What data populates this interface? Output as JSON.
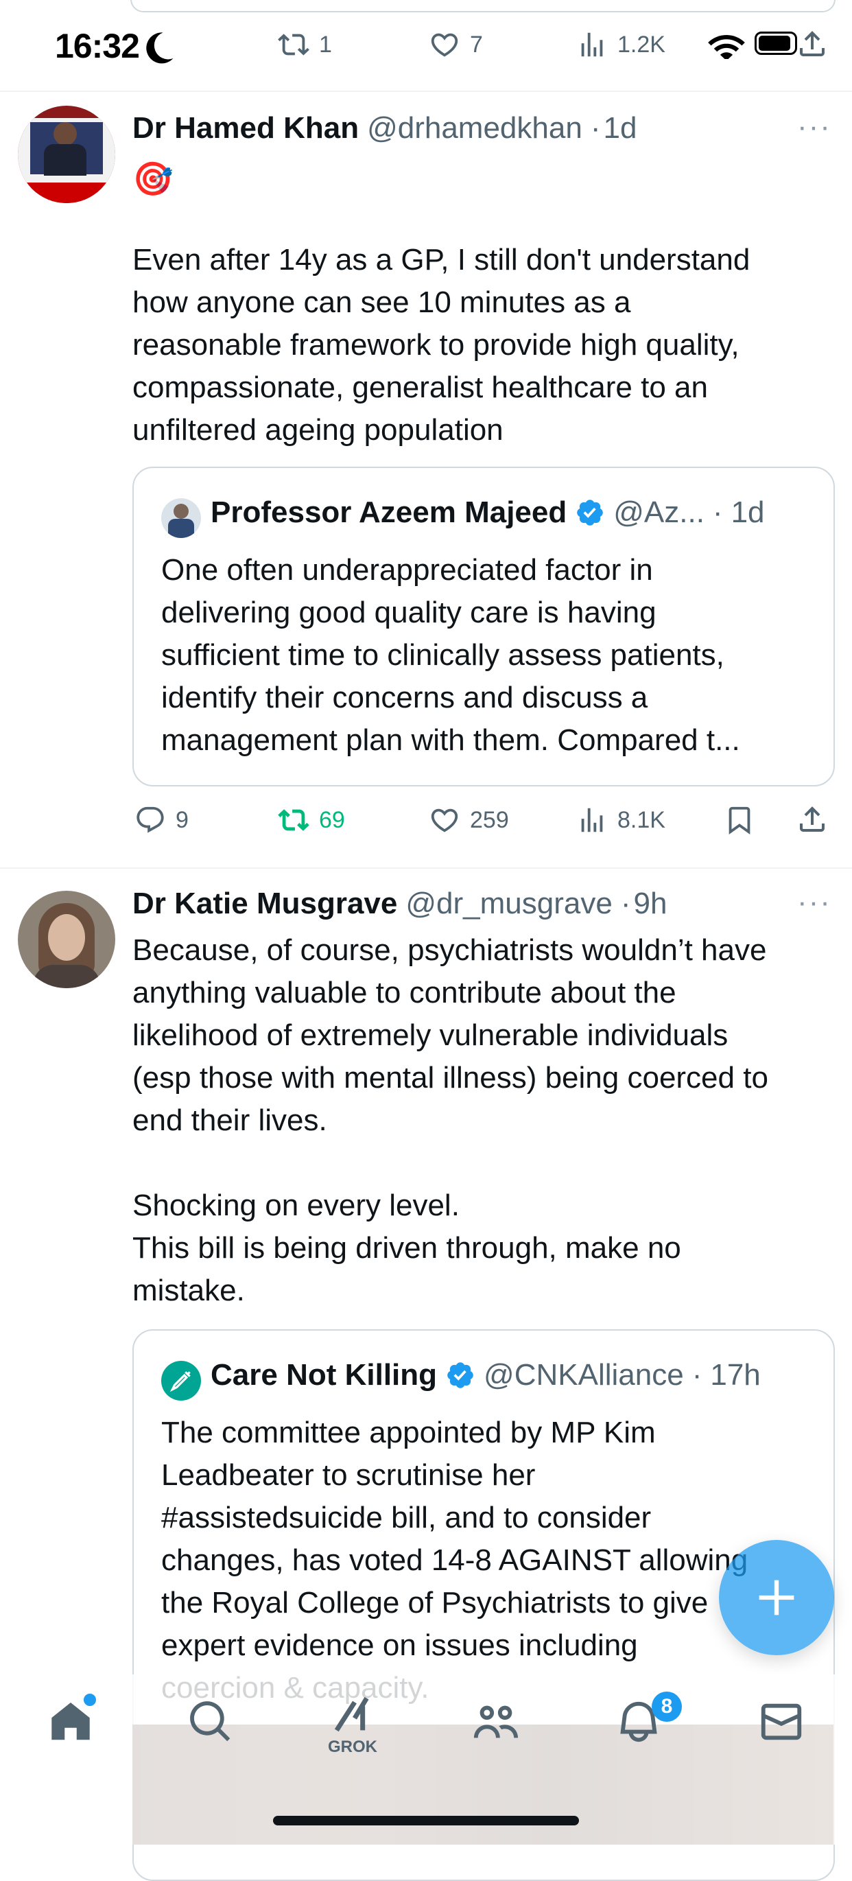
{
  "status_bar": {
    "time": "16:32"
  },
  "top_actions": {
    "retweets": "1",
    "likes": "7",
    "views": "1.2K"
  },
  "tweets": [
    {
      "name": "Dr Hamed Khan",
      "handle": "@drhamedkhan",
      "separator": "·",
      "time": "1d",
      "emoji": "🎯",
      "text": "Even after 14y as a GP, I still don't understand\nhow anyone can see 10 minutes as a\nreasonable framework to provide high quality,\ncompassionate, generalist healthcare to an\nunfiltered ageing population",
      "quote": {
        "name": "Professor Azeem Majeed",
        "handle": "@Az...",
        "separator": "·",
        "time": "1d",
        "text": "One often underappreciated factor in\ndelivering good quality care is having\nsufficient time to clinically assess patients,\nidentify their concerns and discuss a\nmanagement plan with them. Compared t..."
      },
      "replies": "9",
      "retweets": "69",
      "likes": "259",
      "views": "8.1K"
    },
    {
      "name": "Dr Katie Musgrave",
      "handle": "@dr_musgrave",
      "separator": "·",
      "time": "9h",
      "text": "Because, of course, psychiatrists wouldn’t have\nanything valuable to contribute about the\nlikelihood of extremely vulnerable individuals\n(esp those with mental illness) being coerced to\nend their lives.\n\nShocking on every level.\nThis bill is being driven through, make no\nmistake.",
      "quote": {
        "name": "Care Not Killing",
        "handle": "@CNKAlliance",
        "separator": "·",
        "time": "17h",
        "text": "The committee appointed by MP Kim\nLeadbeater to scrutinise her\n#assistedsuicide bill, and to consider\nchanges, has voted 14-8 AGAINST allowing\nthe Royal College of Psychiatrists to give\nexpert evidence on issues including\ncoercion & capacity."
      }
    }
  ],
  "tabbar": {
    "grok_label": "GROK",
    "notifications_badge": "8"
  },
  "colors": {
    "accent": "#1d9bf0",
    "retweet_green": "#00ba7c",
    "secondary_text": "#536471",
    "border": "#cfd9de"
  }
}
